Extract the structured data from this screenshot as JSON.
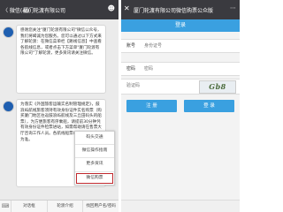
{
  "left": {
    "top_bar": {
      "back_label": "〈 微信(49)",
      "title": "厦门轮渡有限公司"
    },
    "message1": "感谢您关注\"厦门轮渡有限公司\"微信公众号，我们将竭诚为您服务。您可以通过以下方式来了解轮渡：在微信菜单栏【路线信息】中查看各航线信息，或者点击下方菜单\"厦门轮渡有限公司\"了解轮渡，更多资讯请关注微信。",
    "message2": "为落实《外国旅客运输实名制管理规定》，鼓浪屿航线旅客须持有效身份证件实名购票（购买厦门地区往返鼓浪屿航线及三丘田码头的船票），为方便旅客有序乘船，请提前30分钟凭有效身份证件检票进站，如需帮助请在售票大厅咨询工作人员。各航线船票以实际售票情况为准。",
    "menu": [
      "码头交通",
      "微信操作指南",
      "更多资讯",
      "微信购票"
    ],
    "bottom_menu": [
      "对话框",
      "轮渡介绍",
      "找回用户名/密码"
    ]
  },
  "right": {
    "top_bar": {
      "title": "厦门轮渡有限公司微信购票公众版"
    },
    "login_header": "登录",
    "fields": {
      "account_label": "账号",
      "account_placeholder": "身份证号",
      "password_label": "密码",
      "password_placeholder": "密码",
      "captcha_placeholder": "验证码",
      "captcha_text": "G‍b‍8"
    },
    "buttons": {
      "register": "注 册",
      "login": "登 录"
    }
  }
}
